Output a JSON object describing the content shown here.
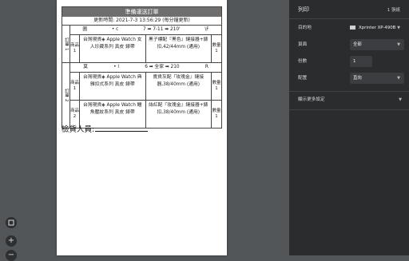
{
  "sheet": {
    "title": "準備運送訂單",
    "updated": "更新時間: 2021-7-3 13:56:29 (每分鐘更新)",
    "orders": [
      {
        "label": "訂單 1",
        "head": [
          "圖",
          "• c",
          "7 ➡ 7-11 ➡ 210'",
          "\\F"
        ],
        "item_label": "商品 1",
        "items": [
          "台灣現貨◈ Apple Watch 女人珍藏系列 真皮 錶帶",
          "黑子標配『黑色』鏈接器+錶扣,42/44mm (通用)"
        ],
        "qty": "數量 1"
      },
      {
        "label": "訂單 2",
        "head": [
          "莫",
          "• l",
          "6 ➡ 全家 ➡ 210",
          "R"
        ],
        "item_label": "商品 1",
        "items": [
          "台灣現貨◈ Apple Watch 典雅扣式系列 真皮 錶帶",
          "賣貨灰配『玫瑰金』鏈接器,38/40mm (通用)"
        ],
        "qty": "數量 1",
        "item2_label": "商品 2",
        "items2": [
          "台灣現貨◈ Apple Watch 鱷魚壓紋系列 真皮 錶帶",
          "絲紅配『玫瑰金』鏈接器+錶扣,38/40mm (通用)"
        ],
        "qty2": "數量 1"
      }
    ],
    "inspector_label": "檢貨人員:"
  },
  "panel": {
    "title": "列印",
    "count": "1 張紙",
    "destination_label": "目的地",
    "destination_value": "Xprinter XP-490B",
    "pages_label": "頁面",
    "pages_value": "全部",
    "copies_label": "份數",
    "copies_value": "1",
    "layout_label": "配置",
    "layout_value": "直向",
    "more_settings": "顯示更多設定"
  },
  "icons": {
    "fit": "fit-to-page-icon",
    "zoom_in": "zoom-in-icon",
    "zoom_out": "zoom-out-icon",
    "printer": "printer-icon"
  }
}
